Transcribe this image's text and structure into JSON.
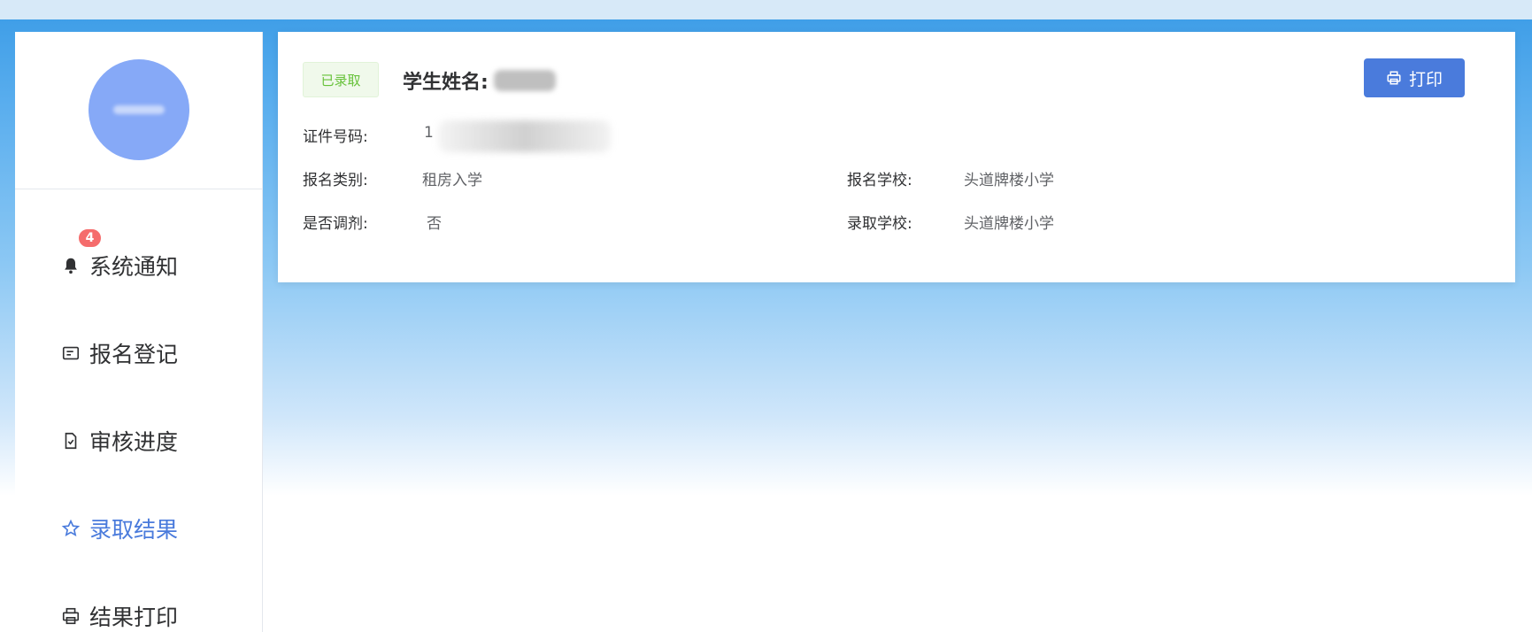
{
  "sidebar": {
    "notification_badge": "4",
    "items": [
      {
        "label": "系统通知",
        "icon": "bell-icon"
      },
      {
        "label": "报名登记",
        "icon": "id-card-icon"
      },
      {
        "label": "审核进度",
        "icon": "document-check-icon"
      },
      {
        "label": "录取结果",
        "icon": "star-icon",
        "active": true
      },
      {
        "label": "结果打印",
        "icon": "printer-icon"
      }
    ]
  },
  "card": {
    "status": "已录取",
    "name_label": "学生姓名:",
    "print_label": "打印",
    "fields": {
      "id_label": "证件号码:",
      "id_value": "1",
      "category_label": "报名类别:",
      "category_value": "租房入学",
      "school_label": "报名学校:",
      "school_value": "头道牌楼小学",
      "adjust_label": "是否调剂:",
      "adjust_value": "否",
      "admitted_label": "录取学校:",
      "admitted_value": "头道牌楼小学"
    }
  },
  "colors": {
    "accent": "#4a7bdc",
    "success": "#67c23a",
    "badge": "#f56c6c"
  }
}
